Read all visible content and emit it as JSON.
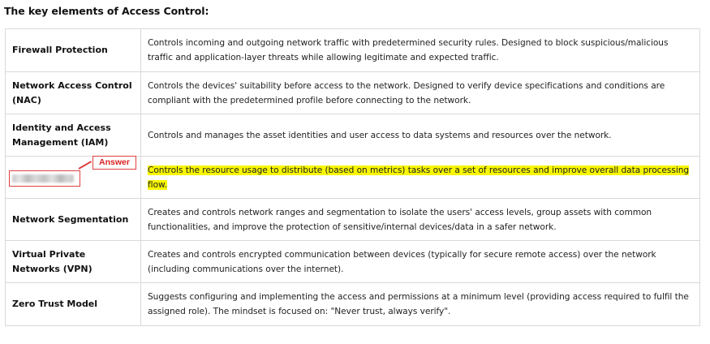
{
  "heading": "The key elements of Access Control:",
  "rows": [
    {
      "term": "Firewall Protection",
      "description": "Controls incoming and outgoing network traffic with predetermined security rules. Designed to block suspicious/malicious traffic and application-layer threats while allowing legitimate and expected traffic."
    },
    {
      "term": "Network Access Control (NAC)",
      "description": "Controls the devices' suitability before access to the network. Designed to verify device specifications and conditions are compliant with the predetermined profile before connecting to the network."
    },
    {
      "term": "Identity and Access Management (IAM)",
      "description": "Controls and manages the asset identities and user access to data systems and resources over the network."
    },
    {
      "term": "",
      "description": "Controls the resource usage to distribute (based on metrics) tasks over a set of resources and improve overall data processing flow.",
      "answer_label": "Answer",
      "highlight_color": "#f7f600"
    },
    {
      "term": "Network Segmentation",
      "description": "Creates and controls network ranges and segmentation to isolate the users' access levels, group assets with common functionalities, and improve the protection of sensitive/internal devices/data in a safer network."
    },
    {
      "term": "Virtual Private Networks (VPN)",
      "description": "Creates and controls encrypted communication between devices (typically for secure remote access) over the network (including communications over the internet)."
    },
    {
      "term": "Zero Trust Model",
      "description": "Suggests configuring and implementing the access and permissions at a minimum level (providing access required to fulfil the assigned role). The mindset is focused on: \"Never trust, always verify\"."
    }
  ],
  "colors": {
    "annotation_red": "#e04040",
    "border": "#d9d9d9"
  }
}
